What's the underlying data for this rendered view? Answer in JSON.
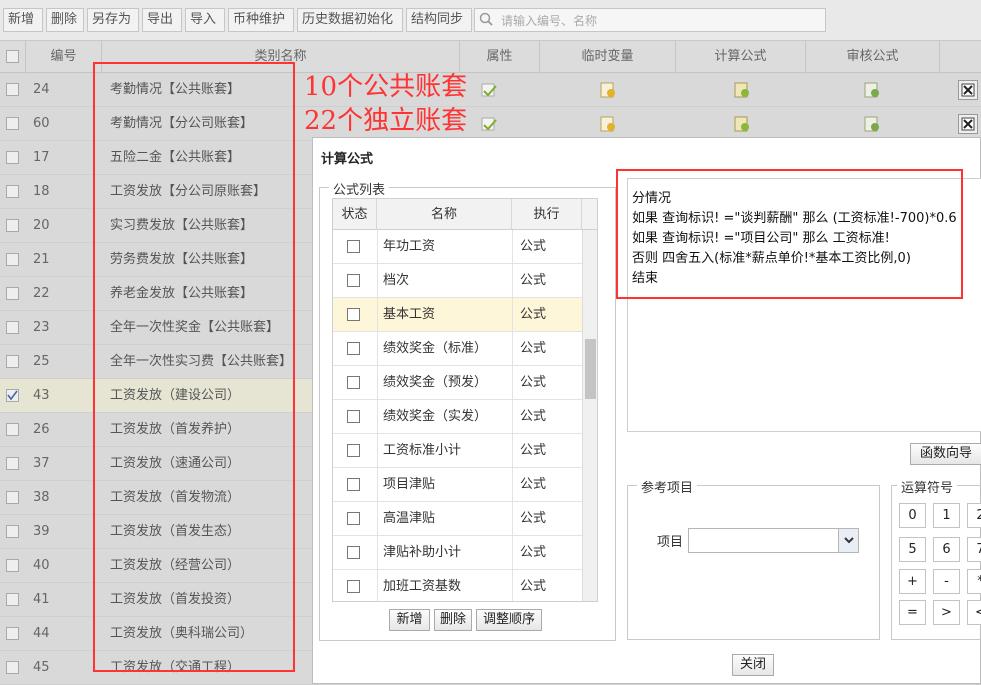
{
  "toolbar": {
    "buttons": [
      "新增",
      "删除",
      "另存为",
      "导出",
      "导入",
      "币种维护",
      "历史数据初始化",
      "结构同步"
    ],
    "search_placeholder": "请输入编号、名称"
  },
  "grid": {
    "headers": [
      "编号",
      "类别名称",
      "属性",
      "临时变量",
      "计算公式",
      "审核公式"
    ],
    "rows": [
      {
        "id": "24",
        "name": "考勤情况【公共账套】",
        "checked": false
      },
      {
        "id": "60",
        "name": "考勤情况【分公司账套】",
        "checked": false
      },
      {
        "id": "17",
        "name": "五险二金【公共账套】",
        "checked": false
      },
      {
        "id": "18",
        "name": "工资发放【分公司原账套】",
        "checked": false
      },
      {
        "id": "20",
        "name": "实习费发放【公共账套】",
        "checked": false
      },
      {
        "id": "21",
        "name": "劳务费发放【公共账套】",
        "checked": false
      },
      {
        "id": "22",
        "name": "养老金发放【公共账套】",
        "checked": false
      },
      {
        "id": "23",
        "name": "全年一次性奖金【公共账套】",
        "checked": false
      },
      {
        "id": "25",
        "name": "全年一次性实习费【公共账套】",
        "checked": false
      },
      {
        "id": "43",
        "name": "工资发放（建设公司）",
        "checked": true
      },
      {
        "id": "26",
        "name": "工资发放（首发养护）",
        "checked": false
      },
      {
        "id": "37",
        "name": "工资发放（速通公司）",
        "checked": false
      },
      {
        "id": "38",
        "name": "工资发放（首发物流）",
        "checked": false
      },
      {
        "id": "39",
        "name": "工资发放（首发生态）",
        "checked": false
      },
      {
        "id": "40",
        "name": "工资发放（经营公司）",
        "checked": false
      },
      {
        "id": "41",
        "name": "工资发放（首发投资）",
        "checked": false
      },
      {
        "id": "44",
        "name": "工资发放（奥科瑞公司）",
        "checked": false
      },
      {
        "id": "45",
        "name": "工资发放（交通工程）",
        "checked": false
      }
    ]
  },
  "annotations": [
    "10个公共账套",
    "22个独立账套"
  ],
  "dialog": {
    "title": "计算公式",
    "formula_list_legend": "公式列表",
    "table_headers": [
      "状态",
      "名称",
      "执行"
    ],
    "formulas": [
      {
        "name": "年功工资",
        "exec": "公式"
      },
      {
        "name": "档次",
        "exec": "公式"
      },
      {
        "name": "基本工资",
        "exec": "公式"
      },
      {
        "name": "绩效奖金（标准）",
        "exec": "公式"
      },
      {
        "name": "绩效奖金（预发）",
        "exec": "公式"
      },
      {
        "name": "绩效奖金（实发）",
        "exec": "公式"
      },
      {
        "name": "工资标准小计",
        "exec": "公式"
      },
      {
        "name": "项目津贴",
        "exec": "公式"
      },
      {
        "name": "高温津贴",
        "exec": "公式"
      },
      {
        "name": "津贴补助小计",
        "exec": "公式"
      },
      {
        "name": "加班工资基数",
        "exec": "公式"
      }
    ],
    "list_buttons": [
      "新增",
      "删除",
      "调整顺序"
    ],
    "formula_lines": [
      "分情况",
      "如果 查询标识! =\"谈判薪酬\" 那么 (工资标准!-700)*0.6",
      "如果 查询标识! =\"项目公司\" 那么 工资标准!",
      "否则 四舍五入(标准*薪点单价!*基本工资比例,0)",
      "结束"
    ],
    "func_wizard_label": "函数向导",
    "ref_legend": "参考项目",
    "item_label": "项目",
    "item_value": "",
    "ops_legend": "运算符号",
    "ops": [
      "0",
      "1",
      "2",
      "5",
      "6",
      "7",
      "+",
      "-",
      "*",
      "=",
      ">",
      "<"
    ],
    "close_label": "关闭"
  }
}
